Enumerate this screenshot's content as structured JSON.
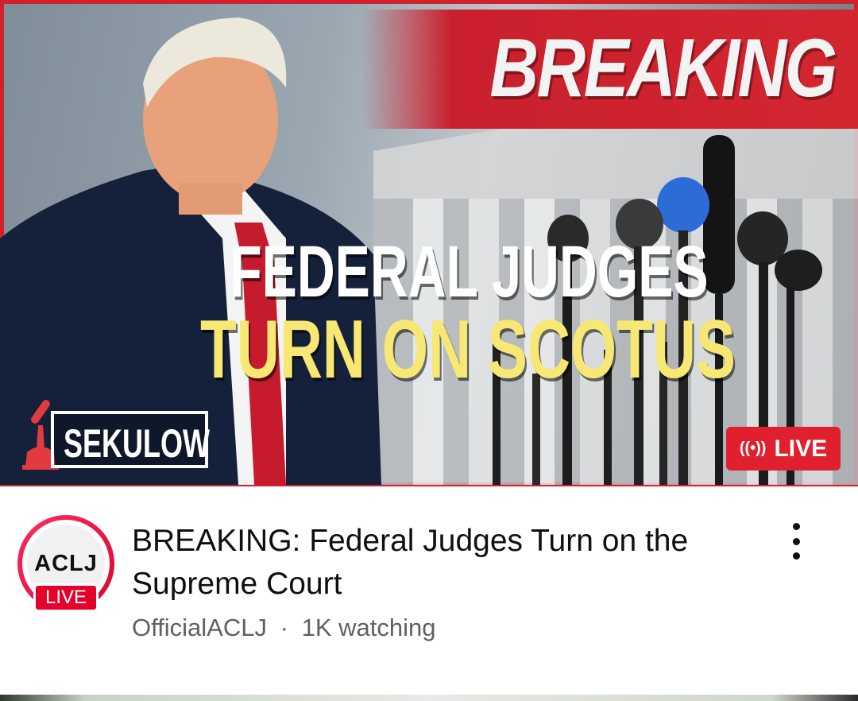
{
  "thumbnail": {
    "banner_text": "BREAKING",
    "headline_line1": "FEDERAL JUDGES",
    "headline_line2": "TURN ON SCOTUS",
    "brand_text": "SEKULOW",
    "live_label": "LIVE",
    "live_icon": "broadcast-icon",
    "colors": {
      "banner_red": "#d3262f",
      "headline_white": "#ffffff",
      "headline_yellow": "#f6e873",
      "live_red": "#e0202f"
    }
  },
  "video": {
    "title": "BREAKING: Federal Judges Turn on the Supreme Court",
    "channel_name": "OfficialACLJ",
    "separator": "·",
    "viewers": "1K watching"
  },
  "channel_avatar": {
    "logo_text": "ACLJ",
    "live_label": "LIVE",
    "ring_color": "#e4002b"
  },
  "menu": {
    "icon": "more-vert-icon"
  }
}
